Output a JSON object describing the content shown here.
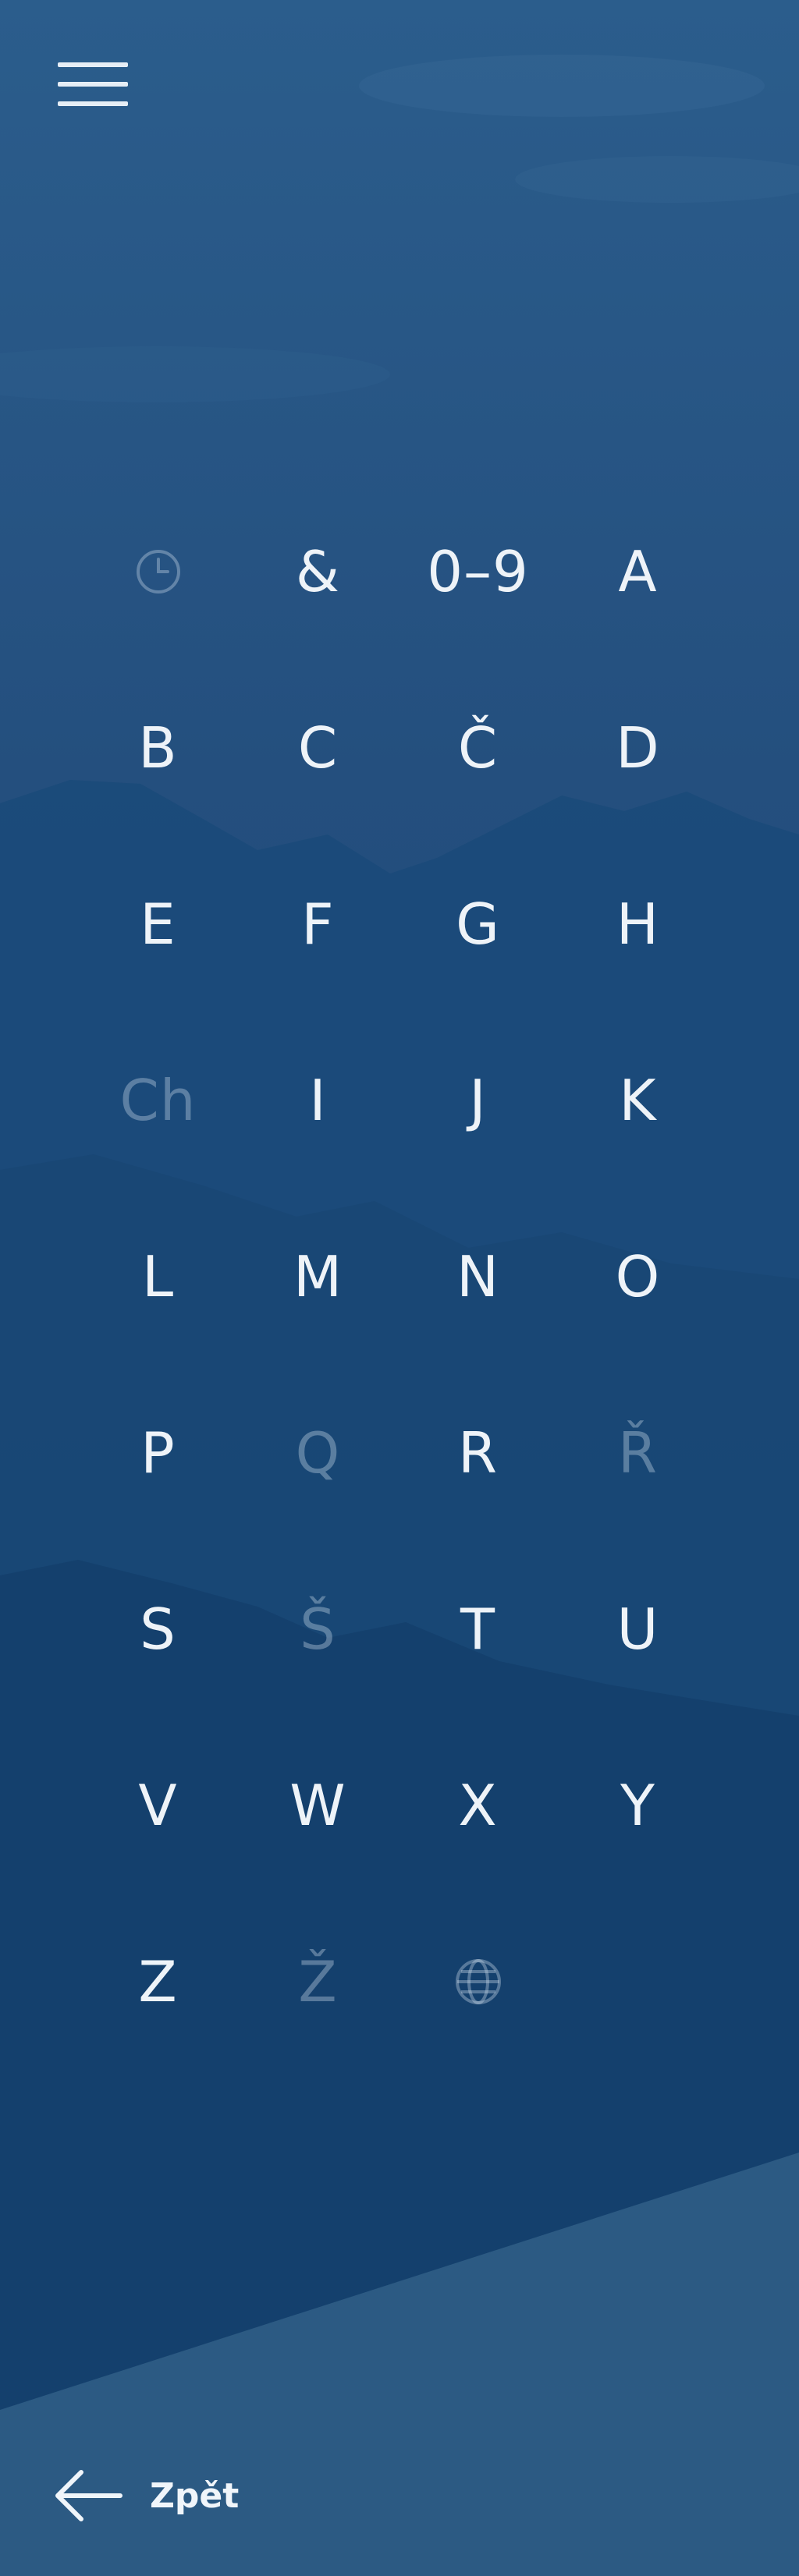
{
  "menu": {
    "icon": "hamburger-menu-icon"
  },
  "index": {
    "cells": [
      {
        "kind": "icon",
        "icon": "clock-icon",
        "enabled": false
      },
      {
        "kind": "text",
        "label": "&",
        "enabled": true
      },
      {
        "kind": "text",
        "label": "0–9",
        "enabled": true
      },
      {
        "kind": "text",
        "label": "A",
        "enabled": true
      },
      {
        "kind": "text",
        "label": "B",
        "enabled": true
      },
      {
        "kind": "text",
        "label": "C",
        "enabled": true
      },
      {
        "kind": "text",
        "label": "Č",
        "enabled": true
      },
      {
        "kind": "text",
        "label": "D",
        "enabled": true
      },
      {
        "kind": "text",
        "label": "E",
        "enabled": true
      },
      {
        "kind": "text",
        "label": "F",
        "enabled": true
      },
      {
        "kind": "text",
        "label": "G",
        "enabled": true
      },
      {
        "kind": "text",
        "label": "H",
        "enabled": true
      },
      {
        "kind": "text",
        "label": "Ch",
        "enabled": false
      },
      {
        "kind": "text",
        "label": "I",
        "enabled": true
      },
      {
        "kind": "text",
        "label": "J",
        "enabled": true
      },
      {
        "kind": "text",
        "label": "K",
        "enabled": true
      },
      {
        "kind": "text",
        "label": "L",
        "enabled": true
      },
      {
        "kind": "text",
        "label": "M",
        "enabled": true
      },
      {
        "kind": "text",
        "label": "N",
        "enabled": true
      },
      {
        "kind": "text",
        "label": "O",
        "enabled": true
      },
      {
        "kind": "text",
        "label": "P",
        "enabled": true
      },
      {
        "kind": "text",
        "label": "Q",
        "enabled": false
      },
      {
        "kind": "text",
        "label": "R",
        "enabled": true
      },
      {
        "kind": "text",
        "label": "Ř",
        "enabled": false
      },
      {
        "kind": "text",
        "label": "S",
        "enabled": true
      },
      {
        "kind": "text",
        "label": "Š",
        "enabled": false
      },
      {
        "kind": "text",
        "label": "T",
        "enabled": true
      },
      {
        "kind": "text",
        "label": "U",
        "enabled": true
      },
      {
        "kind": "text",
        "label": "V",
        "enabled": true
      },
      {
        "kind": "text",
        "label": "W",
        "enabled": true
      },
      {
        "kind": "text",
        "label": "X",
        "enabled": true
      },
      {
        "kind": "text",
        "label": "Y",
        "enabled": true
      },
      {
        "kind": "text",
        "label": "Z",
        "enabled": true
      },
      {
        "kind": "text",
        "label": "Ž",
        "enabled": false
      },
      {
        "kind": "icon",
        "icon": "globe-icon",
        "enabled": false
      }
    ]
  },
  "footer": {
    "back_icon": "arrow-left-icon",
    "back_label": "Zpět"
  },
  "colors": {
    "background": "#1e4a78",
    "text": "#eef3f8",
    "disabled_text": "#7f9bbb"
  }
}
